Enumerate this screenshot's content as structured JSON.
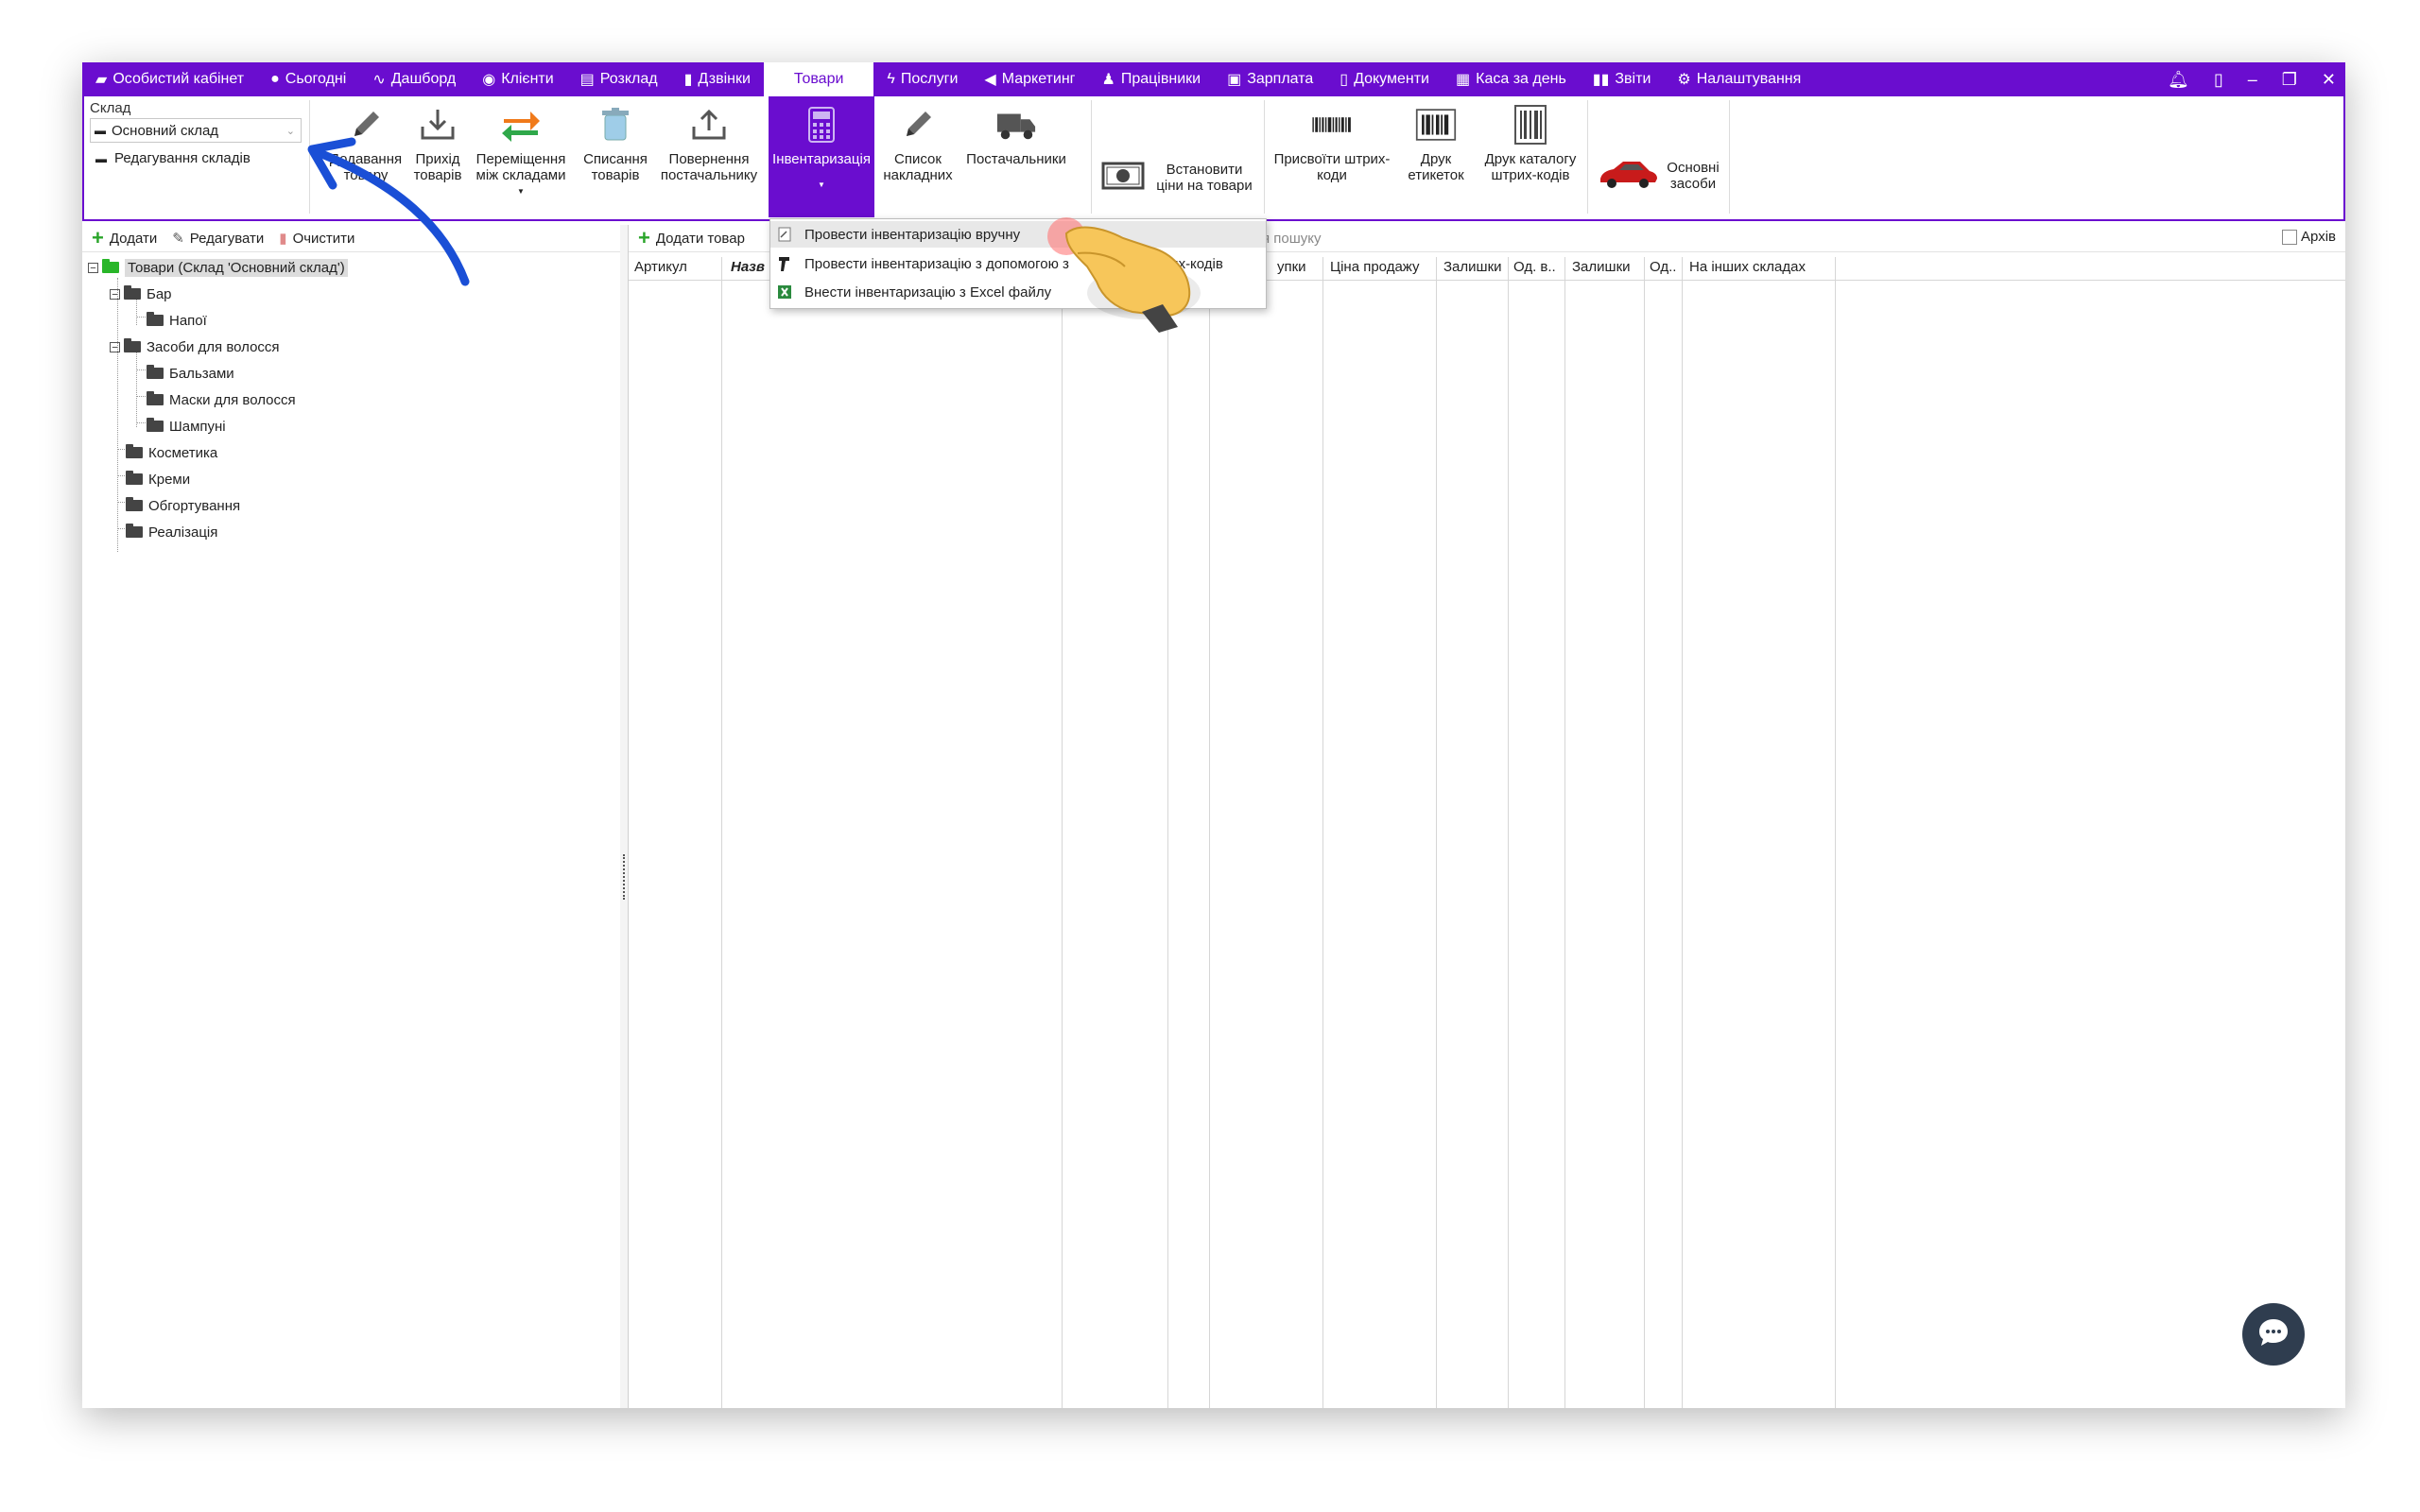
{
  "nav": {
    "items": [
      {
        "label": "Особистий кабінет",
        "icon": "briefcase-icon",
        "glyph": "💼"
      },
      {
        "label": "Сьогодні",
        "icon": "clock-icon",
        "glyph": "⏲"
      },
      {
        "label": "Дашборд",
        "icon": "pulse-icon",
        "glyph": "∿"
      },
      {
        "label": "Клієнти",
        "icon": "user-circle-icon",
        "glyph": "◉"
      },
      {
        "label": "Розклад",
        "icon": "calendar-icon",
        "glyph": "▤"
      },
      {
        "label": "Дзвінки",
        "icon": "phone-icon",
        "glyph": "☎"
      },
      {
        "label": "Товари",
        "icon": "",
        "glyph": ""
      },
      {
        "label": "Послуги",
        "icon": "bolt-icon",
        "glyph": "ϟ"
      },
      {
        "label": "Маркетинг",
        "icon": "megaphone-icon",
        "glyph": "📢"
      },
      {
        "label": "Працівники",
        "icon": "person-icon",
        "glyph": "👤"
      },
      {
        "label": "Зарплата",
        "icon": "money-icon",
        "glyph": "▣"
      },
      {
        "label": "Документи",
        "icon": "document-icon",
        "glyph": "▯"
      },
      {
        "label": "Каса за день",
        "icon": "calculator-icon",
        "glyph": "▦"
      },
      {
        "label": "Звіти",
        "icon": "bar-chart-icon",
        "glyph": "▮"
      },
      {
        "label": "Налаштування",
        "icon": "gear-icon",
        "glyph": "⚙"
      }
    ],
    "active_index": 6
  },
  "warehouse": {
    "label": "Склад",
    "selected": "Основний склад",
    "edit_label": "Редагування складів"
  },
  "ribbon": {
    "add_goods": "Додавання товару",
    "arrival": "Прихід товарів",
    "move": "Переміщення між складами",
    "writeoff": "Списання товарів",
    "return": "Повернення постачальнику",
    "inventory": "Інвентаризація",
    "invoices": "Список накладних",
    "suppliers": "Постачальники",
    "set_prices": "Встановити ціни на товари",
    "assign_barcodes": "Присвоїти штрих-коди",
    "print_labels": "Друк етикеток",
    "print_catalog": "Друк каталогу штрих-кодів",
    "fixed_assets": "Основні засоби"
  },
  "left_toolbar": {
    "add": "Додати",
    "edit": "Редагувати",
    "clear": "Очистити"
  },
  "tree": {
    "root": "Товари (Склад 'Основний склад')",
    "nodes": [
      {
        "label": "Бар",
        "level": 1,
        "expander": "−"
      },
      {
        "label": "Напої",
        "level": 2
      },
      {
        "label": "Засоби для волосся",
        "level": 1,
        "expander": "−"
      },
      {
        "label": "Бальзами",
        "level": 2
      },
      {
        "label": "Маски для волосся",
        "level": 2
      },
      {
        "label": "Шампуні",
        "level": 2
      },
      {
        "label": "Косметика",
        "level": 1
      },
      {
        "label": "Креми",
        "level": 1
      },
      {
        "label": "Обгортування",
        "level": 1
      },
      {
        "label": "Реалізація",
        "level": 1
      }
    ]
  },
  "right_toolbar": {
    "add_product": "Додати товар",
    "search_placeholder": "я пошуку",
    "archive": "Архів"
  },
  "grid": {
    "columns": [
      "Артикул",
      "Назв",
      "",
      "",
      "упки",
      "Ціна продажу",
      "Залишки",
      "Од. в..",
      "Залишки",
      "Од..",
      "На інших складах"
    ]
  },
  "dropdown": {
    "items": [
      "Провести інвентаризацію вручну",
      "Провести інвентаризацію з допомогою з",
      "штрих-кодів",
      "Внести інвентаризацію з Excel файлу"
    ]
  },
  "colors": {
    "accent": "#6a0dcf",
    "arrow": "#1a4fd6",
    "chat": "#2f3d4f"
  }
}
